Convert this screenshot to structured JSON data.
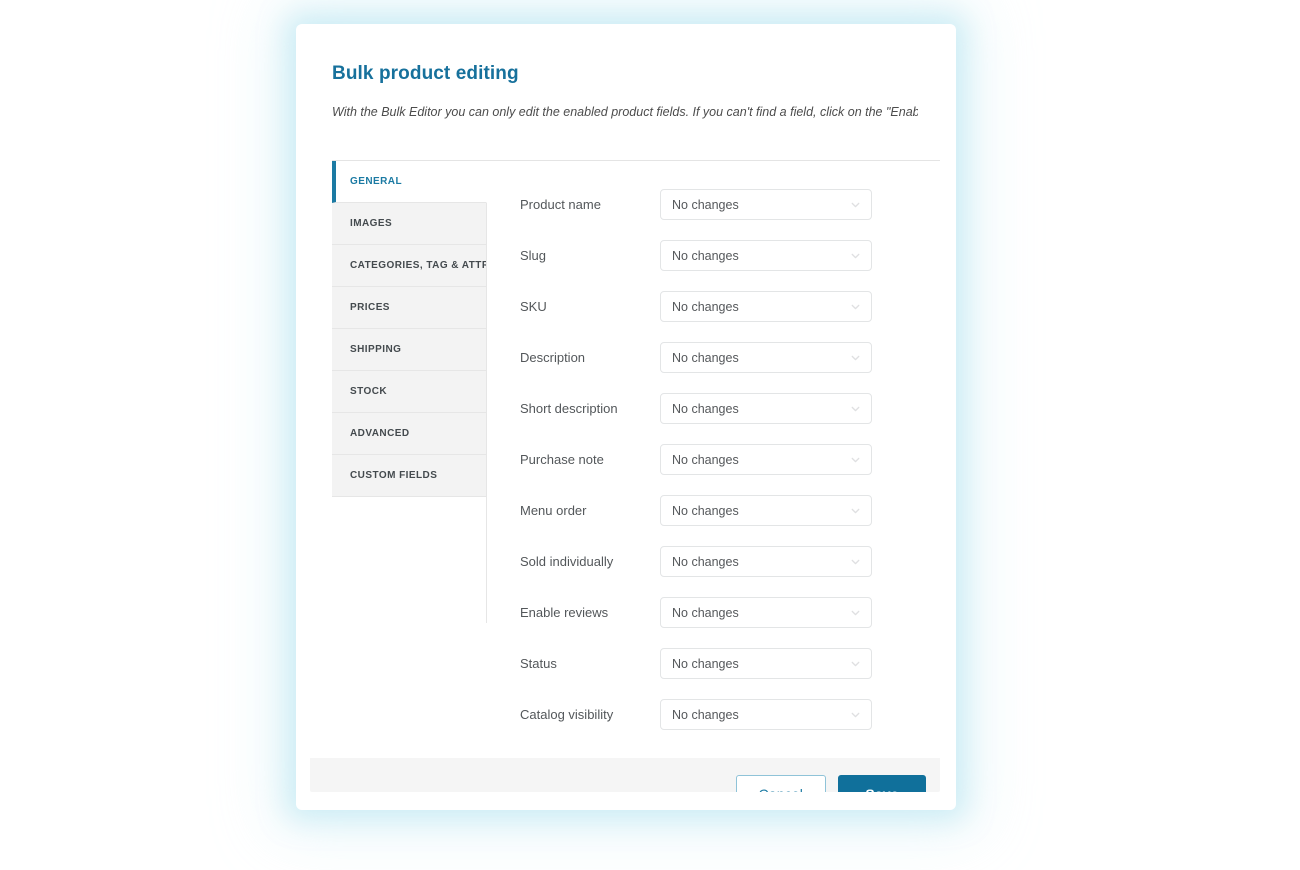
{
  "modal": {
    "title": "Bulk product editing",
    "subtitle": "With the Bulk Editor you can only edit the enabled product fields. If you can't find a field, click on the \"Enable fields\" button in step",
    "accent_color": "#17719c",
    "save_button_color": "#10709b",
    "footer_background": "#f5f5f5"
  },
  "tabs": [
    {
      "label": "GENERAL",
      "active": true
    },
    {
      "label": "IMAGES",
      "active": false
    },
    {
      "label": "CATEGORIES, TAG & ATTRIBUTES",
      "active": false
    },
    {
      "label": "PRICES",
      "active": false
    },
    {
      "label": "SHIPPING",
      "active": false
    },
    {
      "label": "STOCK",
      "active": false
    },
    {
      "label": "ADVANCED",
      "active": false
    },
    {
      "label": "CUSTOM FIELDS",
      "active": false
    }
  ],
  "fields": [
    {
      "label": "Product name",
      "value": "No changes"
    },
    {
      "label": "Slug",
      "value": "No changes"
    },
    {
      "label": "SKU",
      "value": "No changes"
    },
    {
      "label": "Description",
      "value": "No changes"
    },
    {
      "label": "Short description",
      "value": "No changes"
    },
    {
      "label": "Purchase note",
      "value": "No changes"
    },
    {
      "label": "Menu order",
      "value": "No changes"
    },
    {
      "label": "Sold individually",
      "value": "No changes"
    },
    {
      "label": "Enable reviews",
      "value": "No changes"
    },
    {
      "label": "Status",
      "value": "No changes"
    },
    {
      "label": "Catalog visibility",
      "value": "No changes"
    }
  ],
  "footer": {
    "cancel_label": "Cancel",
    "save_label": "Save"
  }
}
